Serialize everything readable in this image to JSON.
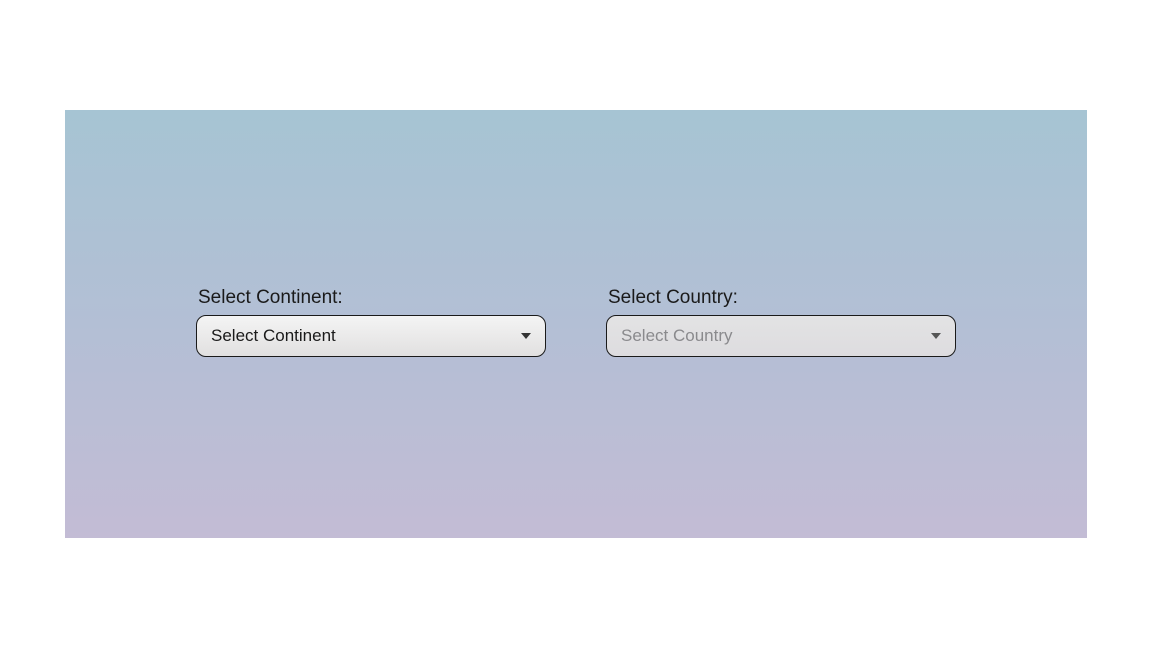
{
  "continent": {
    "label": "Select Continent:",
    "selected": "Select Continent"
  },
  "country": {
    "label": "Select Country:",
    "selected": "Select Country"
  }
}
